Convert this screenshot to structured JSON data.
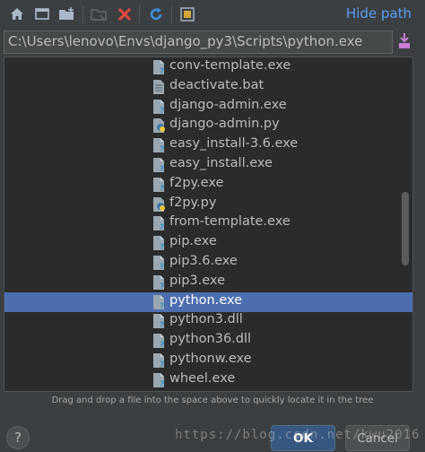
{
  "toolbar": {
    "icons": [
      "home-icon",
      "desktop-icon",
      "new-folder-icon",
      "folder-disabled-icon",
      "delete-icon",
      "refresh-icon",
      "show-hidden-icon"
    ],
    "hide_path_label": "Hide path"
  },
  "path": {
    "value": "C:\\Users\\lenovo\\Envs\\django_py3\\Scripts\\python.exe"
  },
  "tree": {
    "items": [
      {
        "label": "conv-template.exe",
        "type": "unknown"
      },
      {
        "label": "deactivate.bat",
        "type": "text"
      },
      {
        "label": "django-admin.exe",
        "type": "unknown"
      },
      {
        "label": "django-admin.py",
        "type": "python"
      },
      {
        "label": "easy_install-3.6.exe",
        "type": "unknown"
      },
      {
        "label": "easy_install.exe",
        "type": "unknown"
      },
      {
        "label": "f2py.exe",
        "type": "unknown"
      },
      {
        "label": "f2py.py",
        "type": "python"
      },
      {
        "label": "from-template.exe",
        "type": "unknown"
      },
      {
        "label": "pip.exe",
        "type": "unknown"
      },
      {
        "label": "pip3.6.exe",
        "type": "unknown"
      },
      {
        "label": "pip3.exe",
        "type": "unknown"
      },
      {
        "label": "python.exe",
        "type": "unknown",
        "selected": true
      },
      {
        "label": "python3.dll",
        "type": "unknown"
      },
      {
        "label": "python36.dll",
        "type": "unknown"
      },
      {
        "label": "pythonw.exe",
        "type": "unknown"
      },
      {
        "label": "wheel.exe",
        "type": "unknown"
      }
    ]
  },
  "hint": "Drag and drop a file into the space above to quickly locate it in the tree",
  "buttons": {
    "help": "?",
    "ok": "OK",
    "cancel": "Cancel"
  },
  "watermark": "https://blog.csdn.net/kwu2016",
  "colors": {
    "background": "#3c3f41",
    "tree_background": "#2b2b2b",
    "selection": "#4b6eaf",
    "link": "#589df6",
    "delete_red": "#e84a3c",
    "refresh_blue": "#3d8fd6"
  }
}
